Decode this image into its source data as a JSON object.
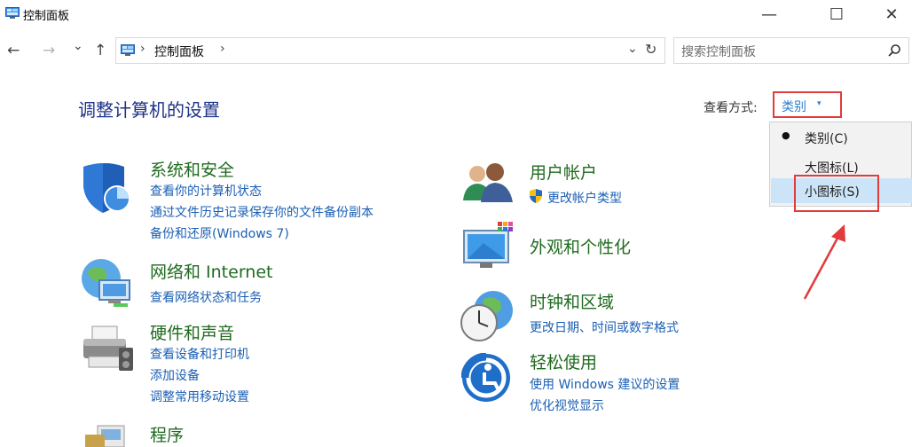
{
  "window": {
    "title": "控制面板",
    "minimize_glyph": "—",
    "maximize_glyph": "☐",
    "close_glyph": "✕"
  },
  "nav": {
    "back_glyph": "←",
    "forward_glyph": "→",
    "recent_glyph": "⌄",
    "up_glyph": "↑",
    "path_separator": "›",
    "path": [
      "控制面板"
    ],
    "dropdown_glyph": "⌄",
    "refresh_glyph": "↻"
  },
  "search": {
    "placeholder": "搜索控制面板",
    "icon": "search-icon"
  },
  "main": {
    "heading": "调整计算机的设置",
    "view_by_label": "查看方式:",
    "view_by_value": "类别",
    "view_by_caret": "▾"
  },
  "view_menu": {
    "items": [
      {
        "label": "类别(C)",
        "selected": true
      },
      {
        "label": "大图标(L)",
        "selected": false
      },
      {
        "label": "小图标(S)",
        "selected": false,
        "hovered": true
      }
    ],
    "bullet": "●"
  },
  "categories": {
    "system": {
      "title": "系统和安全",
      "icon": "shield-icon",
      "links": [
        "查看你的计算机状态",
        "通过文件历史记录保存你的文件备份副本",
        "备份和还原(Windows 7)"
      ]
    },
    "network": {
      "title": "网络和 Internet",
      "icon": "network-globe-icon",
      "links": [
        "查看网络状态和任务"
      ]
    },
    "hardware": {
      "title": "硬件和声音",
      "icon": "printer-icon",
      "links": [
        "查看设备和打印机",
        "添加设备",
        "调整常用移动设置"
      ]
    },
    "programs": {
      "title": "程序",
      "icon": "programs-icon",
      "links": []
    },
    "users": {
      "title": "用户帐户",
      "icon": "users-icon",
      "links": [
        "更改帐户类型"
      ]
    },
    "appearance": {
      "title": "外观和个性化",
      "icon": "monitor-icon",
      "links": []
    },
    "clock": {
      "title": "时钟和区域",
      "icon": "clock-globe-icon",
      "links": [
        "更改日期、时间或数字格式"
      ]
    },
    "ease": {
      "title": "轻松使用",
      "icon": "ease-of-access-icon",
      "links": [
        "使用 Windows 建议的设置",
        "优化视觉显示"
      ]
    }
  },
  "colors": {
    "heading": "#1e3287",
    "category_title": "#1f6b1f",
    "link": "#1a5fb4",
    "annotation_red": "#e23b3b",
    "menu_hover": "#cce4f7"
  }
}
